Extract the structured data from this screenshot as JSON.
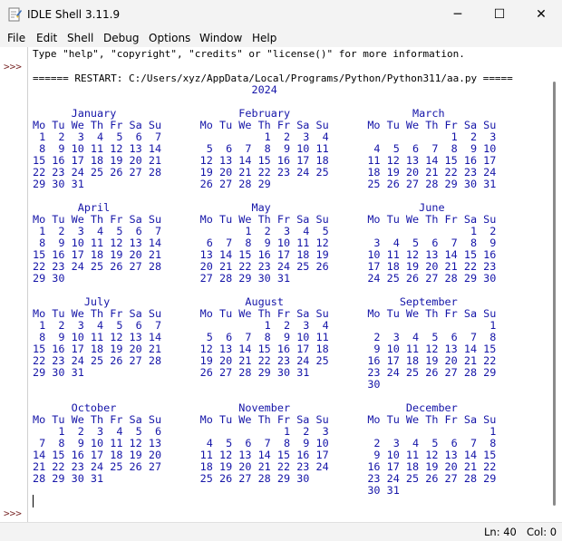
{
  "window": {
    "title": "IDLE Shell 3.11.9",
    "minimize_glyph": "─",
    "maximize_glyph": "☐",
    "close_glyph": "✕"
  },
  "menu": {
    "items": [
      {
        "label": "File"
      },
      {
        "label": "Edit"
      },
      {
        "label": "Shell"
      },
      {
        "label": "Debug"
      },
      {
        "label": "Options"
      },
      {
        "label": "Window"
      },
      {
        "label": "Help"
      }
    ]
  },
  "shell": {
    "prompt": ">>>",
    "banner_line": "Type \"help\", \"copyright\", \"credits\" or \"license()\" for more information.",
    "restart_line": "====== RESTART: C:/Users/xyz/AppData/Local/Programs/Python/Python311/aa.py =====",
    "calendar_output": "                                  2024\n\n      January                   February                   March\nMo Tu We Th Fr Sa Su      Mo Tu We Th Fr Sa Su      Mo Tu We Th Fr Sa Su\n 1  2  3  4  5  6  7                1  2  3  4                   1  2  3\n 8  9 10 11 12 13 14       5  6  7  8  9 10 11       4  5  6  7  8  9 10\n15 16 17 18 19 20 21      12 13 14 15 16 17 18      11 12 13 14 15 16 17\n22 23 24 25 26 27 28      19 20 21 22 23 24 25      18 19 20 21 22 23 24\n29 30 31                  26 27 28 29               25 26 27 28 29 30 31\n\n       April                      May                       June\nMo Tu We Th Fr Sa Su      Mo Tu We Th Fr Sa Su      Mo Tu We Th Fr Sa Su\n 1  2  3  4  5  6  7             1  2  3  4  5                      1  2\n 8  9 10 11 12 13 14       6  7  8  9 10 11 12       3  4  5  6  7  8  9\n15 16 17 18 19 20 21      13 14 15 16 17 18 19      10 11 12 13 14 15 16\n22 23 24 25 26 27 28      20 21 22 23 24 25 26      17 18 19 20 21 22 23\n29 30                     27 28 29 30 31            24 25 26 27 28 29 30\n\n        July                     August                  September\nMo Tu We Th Fr Sa Su      Mo Tu We Th Fr Sa Su      Mo Tu We Th Fr Sa Su\n 1  2  3  4  5  6  7                1  2  3  4                         1\n 8  9 10 11 12 13 14       5  6  7  8  9 10 11       2  3  4  5  6  7  8\n15 16 17 18 19 20 21      12 13 14 15 16 17 18       9 10 11 12 13 14 15\n22 23 24 25 26 27 28      19 20 21 22 23 24 25      16 17 18 19 20 21 22\n29 30 31                  26 27 28 29 30 31         23 24 25 26 27 28 29\n                                                    30\n\n      October                   November                  December\nMo Tu We Th Fr Sa Su      Mo Tu We Th Fr Sa Su      Mo Tu We Th Fr Sa Su\n    1  2  3  4  5  6                   1  2  3                         1\n 7  8  9 10 11 12 13       4  5  6  7  8  9 10       2  3  4  5  6  7  8\n14 15 16 17 18 19 20      11 12 13 14 15 16 17       9 10 11 12 13 14 15\n21 22 23 24 25 26 27      18 19 20 21 22 23 24      16 17 18 19 20 21 22\n28 29 30 31               25 26 27 28 29 30         23 24 25 26 27 28 29\n                                                    30 31"
  },
  "status": {
    "line": "Ln: 40",
    "col": "Col: 0"
  },
  "colors": {
    "output_text": "#1515a8",
    "prompt_text": "#7a2a2a",
    "chrome_bg": "#f3f3f3"
  },
  "icons": {
    "app": "python-feather-icon"
  }
}
